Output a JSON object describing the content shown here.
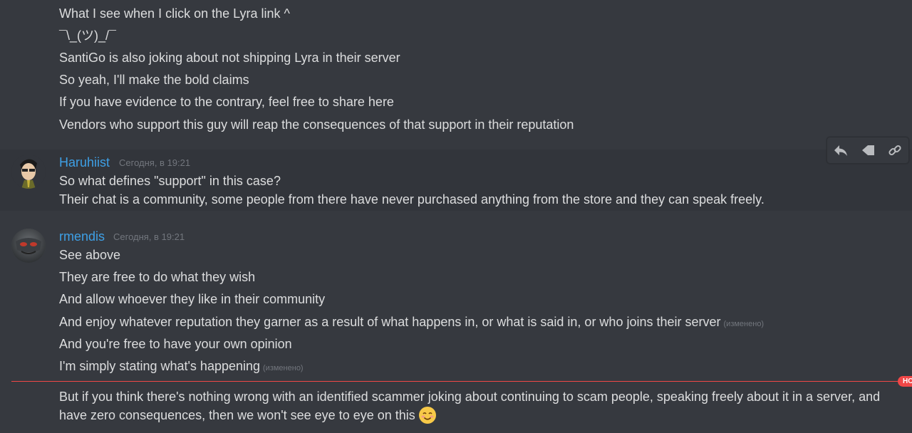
{
  "previous_messages": [
    "What I see when I click on the Lyra link ^",
    "¯\\_(ツ)_/¯",
    "SantiGo is also joking about not shipping Lyra in their server",
    "So yeah, I'll make the bold claims",
    "If you have evidence to the contrary, feel free to share here",
    "Vendors who support this guy will reap the consequences of that support in their reputation"
  ],
  "haruhiist": {
    "username": "Haruhiist",
    "timestamp": "Сегодня, в 19:21",
    "lines": [
      "So what defines \"support\" in this case?",
      "Their chat is a community, some people from there have never purchased anything from the store and they can speak freely."
    ]
  },
  "rmendis": {
    "username": "rmendis",
    "timestamp": "Сегодня, в 19:21",
    "lines": [
      "See above",
      "They are free to do what they wish",
      "And allow whoever they like in their community",
      "And enjoy whatever reputation they garner as a result of what happens in, or what is said in, or who joins their server",
      "And you're free to have your own opinion",
      "I'm simply stating what's happening"
    ],
    "edited_label": "(изменено)",
    "last_message": "But if you think there's nothing wrong with an identified scammer joking about continuing to scam people, speaking freely about it in a server, and have zero consequences, then we won't see eye to eye on this"
  },
  "new_badge": "НО",
  "toolbar": {
    "icons": [
      "reply-icon",
      "pin-icon",
      "link-icon"
    ]
  },
  "colors": {
    "background": "#36393f",
    "username": "#3ea0e6",
    "new_divider": "#f04747"
  }
}
